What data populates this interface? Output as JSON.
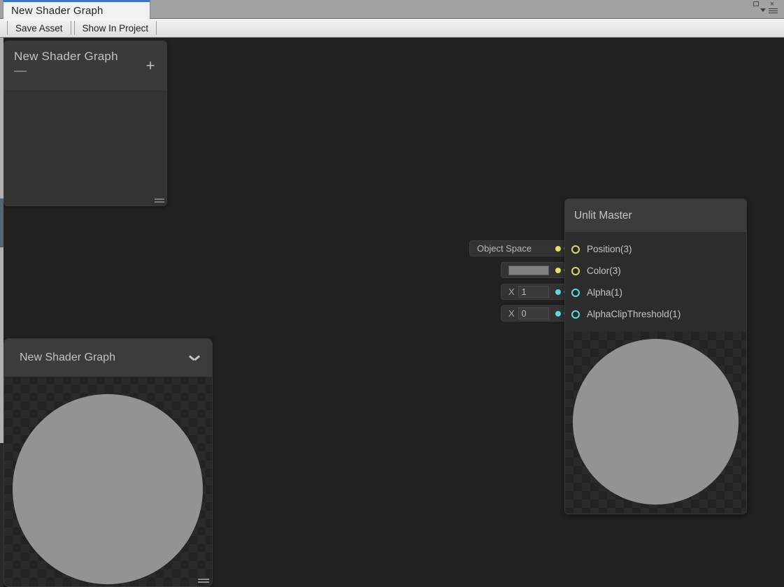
{
  "window": {
    "tab_label": "New Shader Graph",
    "controls": {
      "maximize": "maximize-box",
      "close": "×",
      "caret": "caret-down",
      "menu": "hamburger-menu"
    }
  },
  "toolbar": {
    "save_asset_label": "Save Asset",
    "show_in_project_label": "Show In Project"
  },
  "blackboard": {
    "title": "New Shader Graph",
    "subtitle": "—",
    "add_label": "+",
    "resize_handle": "resize-grip"
  },
  "master_node": {
    "title": "Unlit Master",
    "ports": [
      {
        "label": "Position(3)",
        "type": "vector3",
        "color": "#d8d870"
      },
      {
        "label": "Color(3)",
        "type": "vector3",
        "color": "#d8d870"
      },
      {
        "label": "Alpha(1)",
        "type": "float",
        "color": "#62d8e0"
      },
      {
        "label": "AlphaClipThreshold(1)",
        "type": "float",
        "color": "#62d8e0"
      }
    ]
  },
  "node_inputs": [
    {
      "kind": "dropdown",
      "value": "Object Space",
      "dot_color": "#e4e46c"
    },
    {
      "kind": "color",
      "value": "#808080",
      "dot_color": "#e4e46c"
    },
    {
      "kind": "float",
      "axis": "X",
      "value": "1",
      "dot_color": "#62d8e0"
    },
    {
      "kind": "float",
      "axis": "X",
      "value": "0",
      "dot_color": "#62d8e0"
    }
  ],
  "preview_panel": {
    "title": "New Shader Graph",
    "collapse_icon": "chevron-down",
    "resize_handle": "resize-grip"
  },
  "colors": {
    "canvas_bg": "#212121",
    "node_bg": "#2c2c2c",
    "node_header_bg": "#3c3c3c",
    "sphere": "#939393",
    "tab_accent": "#3a79c4",
    "vector_port": "#d8d870",
    "float_port": "#62d8e0"
  }
}
